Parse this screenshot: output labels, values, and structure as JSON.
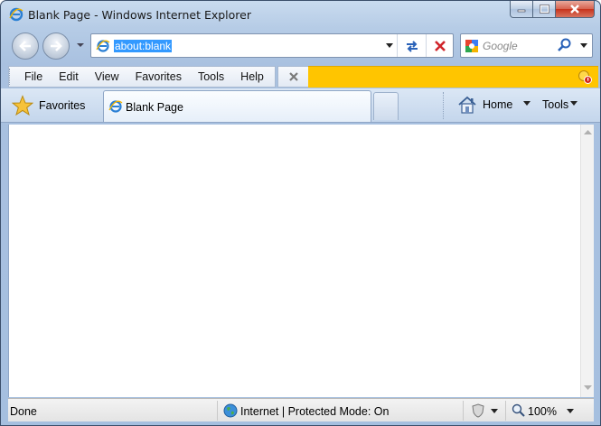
{
  "window": {
    "title": "Blank Page - Windows Internet Explorer"
  },
  "address": {
    "url": "about:blank"
  },
  "search": {
    "placeholder": "Google"
  },
  "menu": {
    "items": [
      "File",
      "Edit",
      "View",
      "Favorites",
      "Tools",
      "Help"
    ]
  },
  "favorites": {
    "label": "Favorites"
  },
  "tab": {
    "label": "Blank Page"
  },
  "commandbar": {
    "home_label": "Home",
    "tools_label": "Tools"
  },
  "status": {
    "text": "Done",
    "zone": "Internet | Protected Mode: On",
    "zoom": "100%"
  },
  "colors": {
    "notification_bar": "#ffc500",
    "selection": "#3399ff",
    "close_button": "#c7331c"
  },
  "icons": [
    "ie-logo-icon",
    "minimize-icon",
    "maximize-icon",
    "close-icon",
    "back-arrow-icon",
    "forward-arrow-icon",
    "refresh-icon",
    "stop-icon",
    "search-icon",
    "google-icon",
    "star-icon",
    "home-icon",
    "globe-icon",
    "shield-icon",
    "zoom-icon"
  ]
}
